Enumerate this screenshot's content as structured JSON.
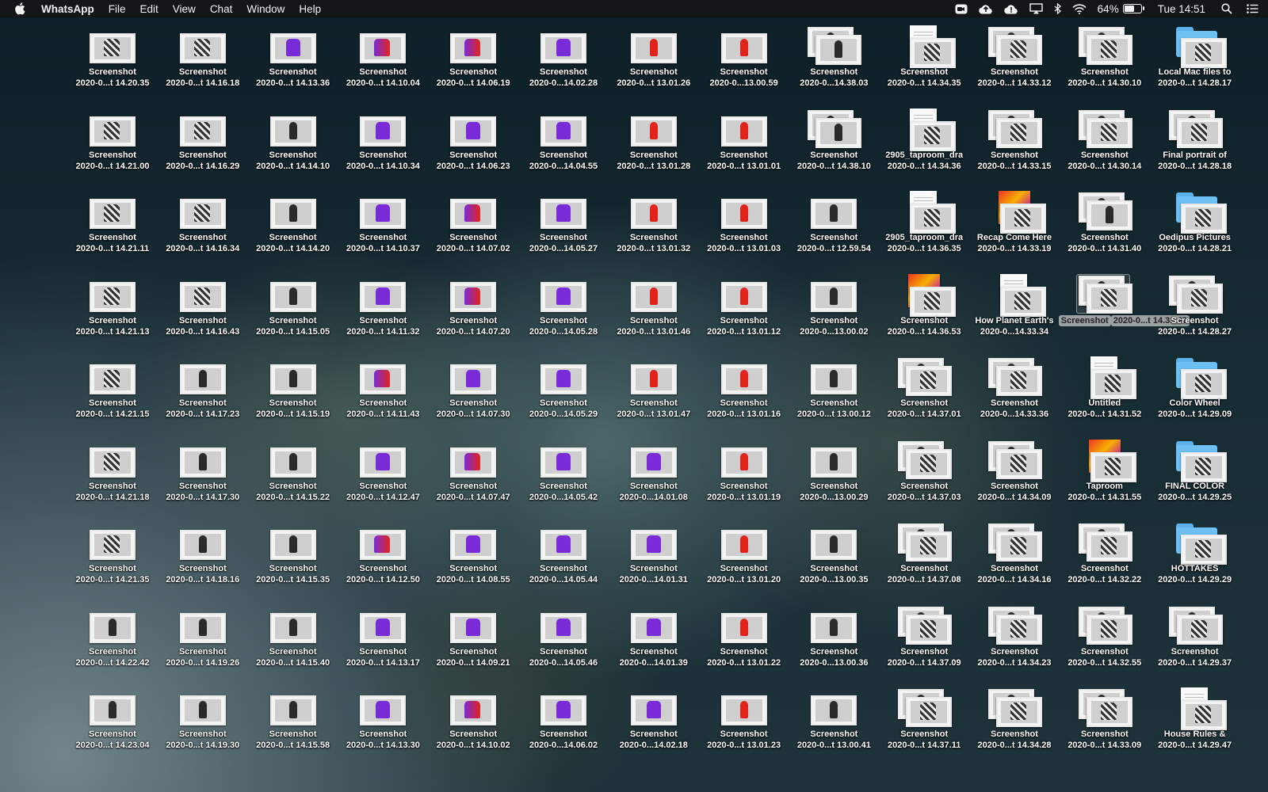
{
  "menubar": {
    "app": "WhatsApp",
    "menus": [
      "File",
      "Edit",
      "View",
      "Chat",
      "Window",
      "Help"
    ],
    "battery_text": "64%",
    "battery_level": 0.64,
    "clock": "Tue 14:51"
  },
  "desktop": {
    "columns": [
      {
        "items": [
          {
            "name": "Screenshot",
            "sub": "2020-0...t 14.20.35",
            "kind": "shot",
            "tint": "check"
          },
          {
            "name": "Screenshot",
            "sub": "2020-0...t 14.21.00",
            "kind": "shot",
            "tint": "check"
          },
          {
            "name": "Screenshot",
            "sub": "2020-0...t 14.21.11",
            "kind": "shot",
            "tint": "check"
          },
          {
            "name": "Screenshot",
            "sub": "2020-0...t 14.21.13",
            "kind": "shot",
            "tint": "check"
          },
          {
            "name": "Screenshot",
            "sub": "2020-0...t 14.21.15",
            "kind": "shot",
            "tint": "check"
          },
          {
            "name": "Screenshot",
            "sub": "2020-0...t 14.21.18",
            "kind": "shot",
            "tint": "check"
          },
          {
            "name": "Screenshot",
            "sub": "2020-0...t 14.21.35",
            "kind": "shot",
            "tint": "check"
          },
          {
            "name": "Screenshot",
            "sub": "2020-0...t 14.22.42",
            "kind": "shot",
            "tint": "dark"
          },
          {
            "name": "Screenshot",
            "sub": "2020-0...t 14.23.04",
            "kind": "shot",
            "tint": "dark"
          }
        ]
      },
      {
        "items": [
          {
            "name": "Screenshot",
            "sub": "2020-0...t 14.16.18",
            "kind": "shot",
            "tint": "check"
          },
          {
            "name": "Screenshot",
            "sub": "2020-0...t 14.16.29",
            "kind": "shot",
            "tint": "check"
          },
          {
            "name": "Screenshot",
            "sub": "2020-0...t 14.16.34",
            "kind": "shot",
            "tint": "check"
          },
          {
            "name": "Screenshot",
            "sub": "2020-0...t 14.16.43",
            "kind": "shot",
            "tint": "check"
          },
          {
            "name": "Screenshot",
            "sub": "2020-0...t 14.17.23",
            "kind": "shot",
            "tint": "dark"
          },
          {
            "name": "Screenshot",
            "sub": "2020-0...t 14.17.30",
            "kind": "shot",
            "tint": "dark"
          },
          {
            "name": "Screenshot",
            "sub": "2020-0...t 14.18.16",
            "kind": "shot",
            "tint": "dark"
          },
          {
            "name": "Screenshot",
            "sub": "2020-0...t 14.19.26",
            "kind": "shot",
            "tint": "dark"
          },
          {
            "name": "Screenshot",
            "sub": "2020-0...t 14.19.30",
            "kind": "shot",
            "tint": "dark"
          }
        ]
      },
      {
        "items": [
          {
            "name": "Screenshot",
            "sub": "2020-0...t 14.13.36",
            "kind": "shot",
            "tint": "purple"
          },
          {
            "name": "Screenshot",
            "sub": "2020-0...t 14.14.10",
            "kind": "shot",
            "tint": "dark"
          },
          {
            "name": "Screenshot",
            "sub": "2020-0...t 14.14.20",
            "kind": "shot",
            "tint": "dark"
          },
          {
            "name": "Screenshot",
            "sub": "2020-0...t 14.15.05",
            "kind": "shot",
            "tint": "dark"
          },
          {
            "name": "Screenshot",
            "sub": "2020-0...t 14.15.19",
            "kind": "shot",
            "tint": "dark"
          },
          {
            "name": "Screenshot",
            "sub": "2020-0...t 14.15.22",
            "kind": "shot",
            "tint": "dark"
          },
          {
            "name": "Screenshot",
            "sub": "2020-0...t 14.15.35",
            "kind": "shot",
            "tint": "dark"
          },
          {
            "name": "Screenshot",
            "sub": "2020-0...t 14.15.40",
            "kind": "shot",
            "tint": "dark"
          },
          {
            "name": "Screenshot",
            "sub": "2020-0...t 14.15.58",
            "kind": "shot",
            "tint": "dark"
          }
        ]
      },
      {
        "items": [
          {
            "name": "Screenshot",
            "sub": "2020-0...t 14.10.04",
            "kind": "shot",
            "tint": "mixed"
          },
          {
            "name": "Screenshot",
            "sub": "2020-0...t 14.10.34",
            "kind": "shot",
            "tint": "purple"
          },
          {
            "name": "Screenshot",
            "sub": "2020-0...t 14.10.37",
            "kind": "shot",
            "tint": "purple"
          },
          {
            "name": "Screenshot",
            "sub": "2020-0...t 14.11.32",
            "kind": "shot",
            "tint": "purple"
          },
          {
            "name": "Screenshot",
            "sub": "2020-0...t 14.11.43",
            "kind": "shot",
            "tint": "mixed"
          },
          {
            "name": "Screenshot",
            "sub": "2020-0...t 14.12.47",
            "kind": "shot",
            "tint": "purple"
          },
          {
            "name": "Screenshot",
            "sub": "2020-0...t 14.12.50",
            "kind": "shot",
            "tint": "mixed"
          },
          {
            "name": "Screenshot",
            "sub": "2020-0...t 14.13.17",
            "kind": "shot",
            "tint": "purple"
          },
          {
            "name": "Screenshot",
            "sub": "2020-0...t 14.13.30",
            "kind": "shot",
            "tint": "purple"
          }
        ]
      },
      {
        "items": [
          {
            "name": "Screenshot",
            "sub": "2020-0...t 14.06.19",
            "kind": "shot",
            "tint": "mixed"
          },
          {
            "name": "Screenshot",
            "sub": "2020-0...t 14.06.23",
            "kind": "shot",
            "tint": "purple"
          },
          {
            "name": "Screenshot",
            "sub": "2020-0...t 14.07.02",
            "kind": "shot",
            "tint": "mixed"
          },
          {
            "name": "Screenshot",
            "sub": "2020-0...t 14.07.20",
            "kind": "shot",
            "tint": "mixed"
          },
          {
            "name": "Screenshot",
            "sub": "2020-0...t 14.07.30",
            "kind": "shot",
            "tint": "purple"
          },
          {
            "name": "Screenshot",
            "sub": "2020-0...t 14.07.47",
            "kind": "shot",
            "tint": "mixed"
          },
          {
            "name": "Screenshot",
            "sub": "2020-0...t 14.08.55",
            "kind": "shot",
            "tint": "purple"
          },
          {
            "name": "Screenshot",
            "sub": "2020-0...t 14.09.21",
            "kind": "shot",
            "tint": "purple"
          },
          {
            "name": "Screenshot",
            "sub": "2020-0...t 14.10.02",
            "kind": "shot",
            "tint": "mixed"
          }
        ]
      },
      {
        "items": [
          {
            "name": "Screenshot",
            "sub": "2020-0...14.02.28",
            "kind": "shot",
            "tint": "purple"
          },
          {
            "name": "Screenshot",
            "sub": "2020-0...14.04.55",
            "kind": "shot",
            "tint": "purple"
          },
          {
            "name": "Screenshot",
            "sub": "2020-0...14.05.27",
            "kind": "shot",
            "tint": "purple"
          },
          {
            "name": "Screenshot",
            "sub": "2020-0...14.05.28",
            "kind": "shot",
            "tint": "purple"
          },
          {
            "name": "Screenshot",
            "sub": "2020-0...14.05.29",
            "kind": "shot",
            "tint": "purple"
          },
          {
            "name": "Screenshot",
            "sub": "2020-0...14.05.42",
            "kind": "shot",
            "tint": "purple"
          },
          {
            "name": "Screenshot",
            "sub": "2020-0...14.05.44",
            "kind": "shot",
            "tint": "purple"
          },
          {
            "name": "Screenshot",
            "sub": "2020-0...14.05.46",
            "kind": "shot",
            "tint": "purple"
          },
          {
            "name": "Screenshot",
            "sub": "2020-0...14.06.02",
            "kind": "shot",
            "tint": "purple"
          }
        ]
      },
      {
        "items": [
          {
            "name": "Screenshot",
            "sub": "2020-0...t 13.01.26",
            "kind": "shot",
            "tint": "red"
          },
          {
            "name": "Screenshot",
            "sub": "2020-0...t 13.01.28",
            "kind": "shot",
            "tint": "red"
          },
          {
            "name": "Screenshot",
            "sub": "2020-0...t 13.01.32",
            "kind": "shot",
            "tint": "red"
          },
          {
            "name": "Screenshot",
            "sub": "2020-0...t 13.01.46",
            "kind": "shot",
            "tint": "red"
          },
          {
            "name": "Screenshot",
            "sub": "2020-0...t 13.01.47",
            "kind": "shot",
            "tint": "red"
          },
          {
            "name": "Screenshot",
            "sub": "2020-0...14.01.08",
            "kind": "shot",
            "tint": "purple"
          },
          {
            "name": "Screenshot",
            "sub": "2020-0...14.01.31",
            "kind": "shot",
            "tint": "purple"
          },
          {
            "name": "Screenshot",
            "sub": "2020-0...14.01.39",
            "kind": "shot",
            "tint": "purple"
          },
          {
            "name": "Screenshot",
            "sub": "2020-0...14.02.18",
            "kind": "shot",
            "tint": "purple"
          }
        ]
      },
      {
        "items": [
          {
            "name": "Screenshot",
            "sub": "2020-0...13.00.59",
            "kind": "shot",
            "tint": "red"
          },
          {
            "name": "Screenshot",
            "sub": "2020-0...t 13.01.01",
            "kind": "shot",
            "tint": "red"
          },
          {
            "name": "Screenshot",
            "sub": "2020-0...t 13.01.03",
            "kind": "shot",
            "tint": "red"
          },
          {
            "name": "Screenshot",
            "sub": "2020-0...t 13.01.12",
            "kind": "shot",
            "tint": "red"
          },
          {
            "name": "Screenshot",
            "sub": "2020-0...t 13.01.16",
            "kind": "shot",
            "tint": "red"
          },
          {
            "name": "Screenshot",
            "sub": "2020-0...t 13.01.19",
            "kind": "shot",
            "tint": "red"
          },
          {
            "name": "Screenshot",
            "sub": "2020-0...t 13.01.20",
            "kind": "shot",
            "tint": "red"
          },
          {
            "name": "Screenshot",
            "sub": "2020-0...t 13.01.22",
            "kind": "shot",
            "tint": "red"
          },
          {
            "name": "Screenshot",
            "sub": "2020-0...t 13.01.23",
            "kind": "shot",
            "tint": "red"
          }
        ]
      },
      {
        "items": [
          {
            "name": "Screenshot",
            "sub": "2020-0...14.38.03",
            "kind": "stack",
            "tint": "dark"
          },
          {
            "name": "Screenshot",
            "sub": "2020-0...t 14.38.10",
            "kind": "stack",
            "tint": "dark"
          },
          {
            "name": "Screenshot",
            "sub": "2020-0...t 12.59.54",
            "kind": "shot",
            "tint": "dark"
          },
          {
            "name": "Screenshot",
            "sub": "2020-0...13.00.02",
            "kind": "shot",
            "tint": "dark"
          },
          {
            "name": "Screenshot",
            "sub": "2020-0...t 13.00.12",
            "kind": "shot",
            "tint": "dark"
          },
          {
            "name": "Screenshot",
            "sub": "2020-0...13.00.29",
            "kind": "shot",
            "tint": "dark"
          },
          {
            "name": "Screenshot",
            "sub": "2020-0...13.00.35",
            "kind": "shot",
            "tint": "dark"
          },
          {
            "name": "Screenshot",
            "sub": "2020-0...13.00.36",
            "kind": "shot",
            "tint": "dark"
          },
          {
            "name": "Screenshot",
            "sub": "2020-0...t 13.00.41",
            "kind": "shot",
            "tint": "dark"
          }
        ]
      },
      {
        "items": [
          {
            "name": "Screenshot",
            "sub": "2020-0...t 14.34.35",
            "kind": "docstack",
            "tint": "check"
          },
          {
            "name": "2905_taproom_dra",
            "sub": "2020-0...t 14.34.36",
            "kind": "docstack",
            "tint": "check"
          },
          {
            "name": "2905_taproom_dra",
            "sub": "2020-0...t 14.36.35",
            "kind": "docstack",
            "tint": "check"
          },
          {
            "name": "Screenshot",
            "sub": "2020-0...t 14.36.53",
            "kind": "posterstack",
            "tint": "check"
          },
          {
            "name": "Screenshot",
            "sub": "2020-0...t 14.37.01",
            "kind": "stack",
            "tint": "check"
          },
          {
            "name": "Screenshot",
            "sub": "2020-0...t 14.37.03",
            "kind": "stack",
            "tint": "check"
          },
          {
            "name": "Screenshot",
            "sub": "2020-0...t 14.37.08",
            "kind": "stack",
            "tint": "check"
          },
          {
            "name": "Screenshot",
            "sub": "2020-0...t 14.37.09",
            "kind": "stack",
            "tint": "check"
          },
          {
            "name": "Screenshot",
            "sub": "2020-0...t 14.37.11",
            "kind": "stack",
            "tint": "check"
          }
        ]
      },
      {
        "items": [
          {
            "name": "Screenshot",
            "sub": "2020-0...t 14.33.12",
            "kind": "stack",
            "tint": "check"
          },
          {
            "name": "Screenshot",
            "sub": "2020-0...t 14.33.15",
            "kind": "stack",
            "tint": "check"
          },
          {
            "name": "Recap Come Here",
            "sub": "2020-0...t 14.33.19",
            "kind": "posterstack",
            "tint": "check"
          },
          {
            "name": "How Planet Earth's",
            "sub": "2020-0...14.33.34",
            "kind": "docstack",
            "tint": "check"
          },
          {
            "name": "Screenshot",
            "sub": "2020-0...14.33.36",
            "kind": "stack",
            "tint": "check"
          },
          {
            "name": "Screenshot",
            "sub": "2020-0...t 14.34.09",
            "kind": "stack",
            "tint": "check"
          },
          {
            "name": "Screenshot",
            "sub": "2020-0...t 14.34.16",
            "kind": "stack",
            "tint": "check"
          },
          {
            "name": "Screenshot",
            "sub": "2020-0...t 14.34.23",
            "kind": "stack",
            "tint": "check"
          },
          {
            "name": "Screenshot",
            "sub": "2020-0...t 14.34.28",
            "kind": "stack",
            "tint": "check"
          }
        ]
      },
      {
        "items": [
          {
            "name": "Screenshot",
            "sub": "2020-0...t 14.30.10",
            "kind": "stack",
            "tint": "check"
          },
          {
            "name": "Screenshot",
            "sub": "2020-0...t 14.30.14",
            "kind": "stack",
            "tint": "check"
          },
          {
            "name": "Screenshot",
            "sub": "2020-0...t 14.31.40",
            "kind": "stack",
            "tint": "dark"
          },
          {
            "name": "Screenshot",
            "sub": "2020-0...t 14.31.42",
            "kind": "stack",
            "tint": "check",
            "selected": true
          },
          {
            "name": "Untitled",
            "sub": "2020-0...t 14.31.52",
            "kind": "docstack",
            "tint": "check"
          },
          {
            "name": "Taproom",
            "sub": "2020-0...t 14.31.55",
            "kind": "posterstack",
            "tint": "check"
          },
          {
            "name": "Screenshot",
            "sub": "2020-0...t 14.32.22",
            "kind": "stack",
            "tint": "check"
          },
          {
            "name": "Screenshot",
            "sub": "2020-0...t 14.32.55",
            "kind": "stack",
            "tint": "check"
          },
          {
            "name": "Screenshot",
            "sub": "2020-0...t 14.33.09",
            "kind": "stack",
            "tint": "check"
          }
        ]
      },
      {
        "items": [
          {
            "name": "Local Mac files to",
            "sub": "2020-0...t 14.28.17",
            "kind": "folderstack",
            "tint": "check"
          },
          {
            "name": "Final portrait of",
            "sub": "2020-0...t 14.28.18",
            "kind": "stack",
            "tint": "check"
          },
          {
            "name": "Oedipus Pictures",
            "sub": "2020-0...t 14.28.21",
            "kind": "folderstack",
            "tint": "check"
          },
          {
            "name": "Screenshot",
            "sub": "2020-0...t 14.28.27",
            "kind": "stack",
            "tint": "check"
          },
          {
            "name": "Color Wheel",
            "sub": "2020-0...t 14.29.09",
            "kind": "folderstack",
            "tint": "check"
          },
          {
            "name": "FINAL COLOR",
            "sub": "2020-0...t 14.29.25",
            "kind": "folderstack",
            "tint": "check"
          },
          {
            "name": "HOTTAKES",
            "sub": "2020-0...t 14.29.29",
            "kind": "folderstack",
            "tint": "check"
          },
          {
            "name": "Screenshot",
            "sub": "2020-0...t 14.29.37",
            "kind": "stack",
            "tint": "check"
          },
          {
            "name": "House Rules &",
            "sub": "2020-0...t 14.29.47",
            "kind": "docstack",
            "tint": "check"
          }
        ]
      }
    ]
  }
}
